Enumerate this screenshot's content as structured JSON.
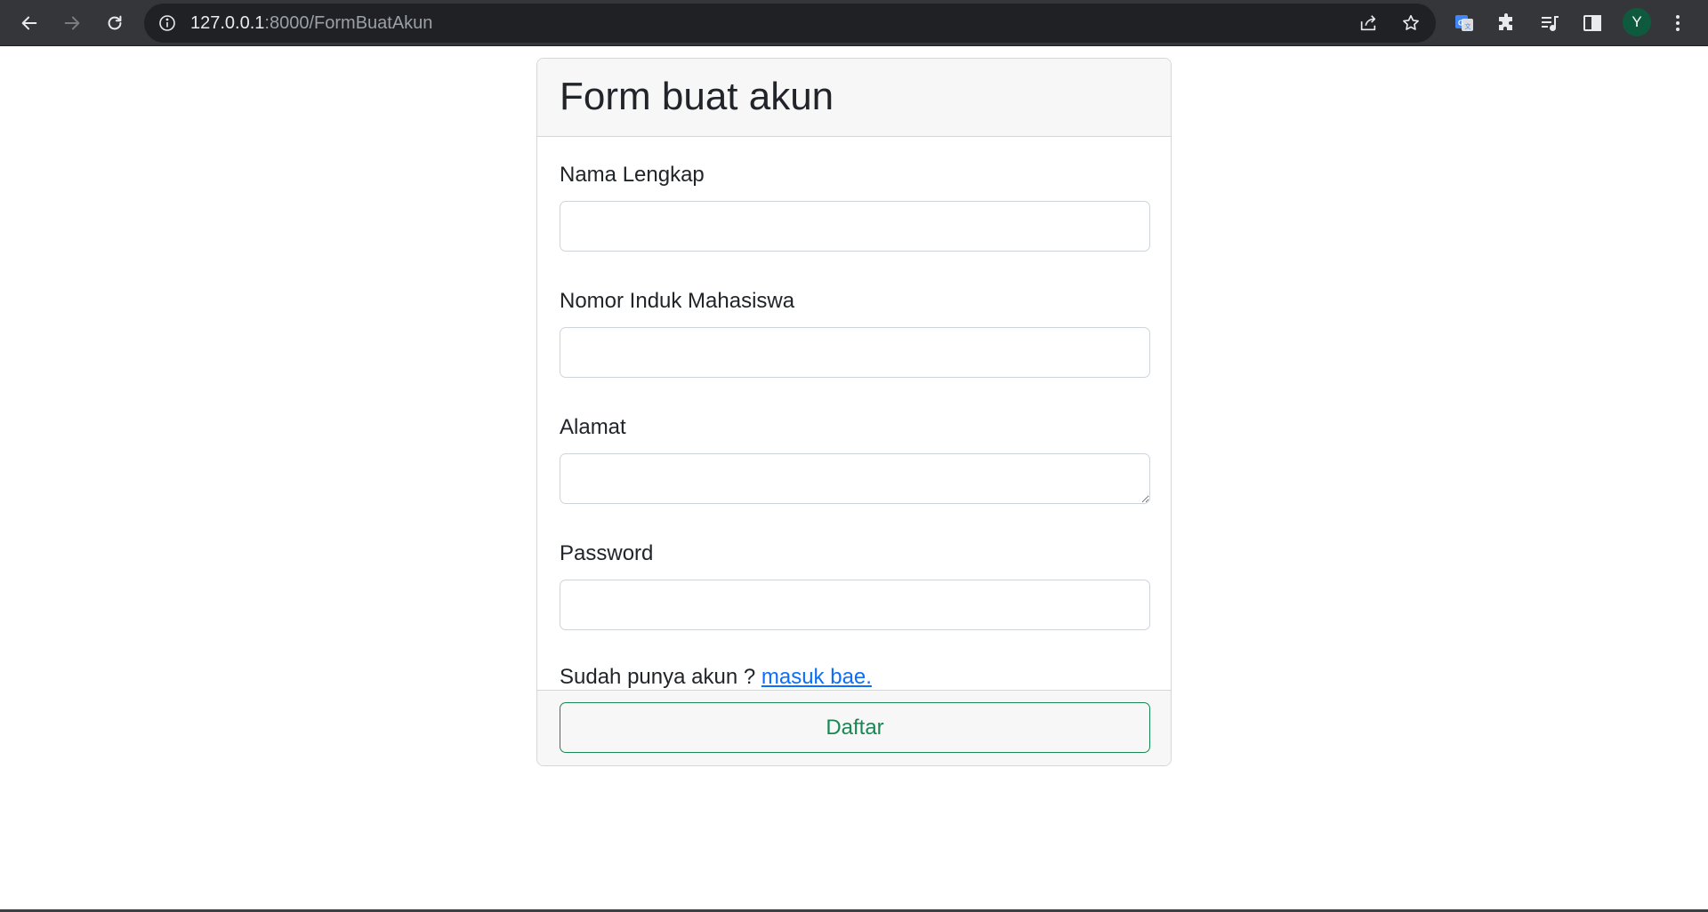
{
  "browser": {
    "url_host": "127.0.0.1",
    "url_rest": ":8000/FormBuatAkun",
    "profile_initial": "Y"
  },
  "form": {
    "title": "Form buat akun",
    "fields": {
      "nama": {
        "label": "Nama Lengkap",
        "value": ""
      },
      "nim": {
        "label": "Nomor Induk Mahasiswa",
        "value": ""
      },
      "alamat": {
        "label": "Alamat",
        "value": ""
      },
      "password": {
        "label": "Password",
        "value": ""
      }
    },
    "helper_text": "Sudah punya akun ? ",
    "login_link": "masuk bae.",
    "submit_label": "Daftar"
  },
  "colors": {
    "toolbar": "#35363a",
    "omnibox": "#202124",
    "link": "#0d6efd",
    "submit": "#198754"
  }
}
